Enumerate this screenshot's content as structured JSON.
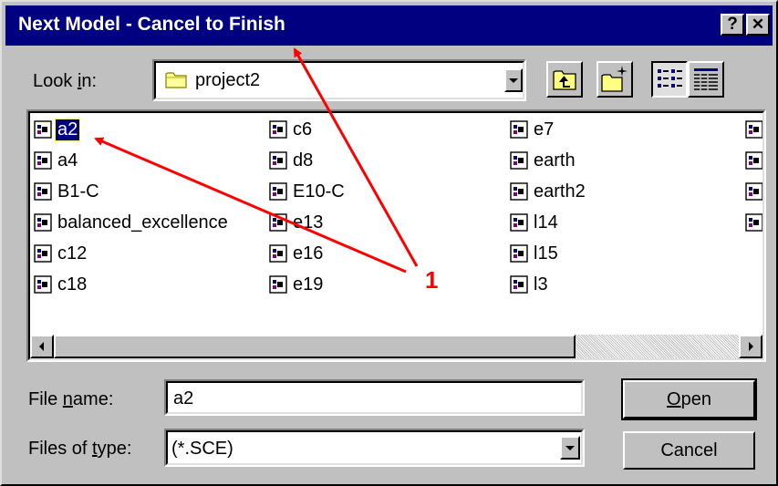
{
  "window": {
    "title": "Next Model - Cancel to Finish",
    "help_label": "?",
    "close_label": "✕"
  },
  "look_in": {
    "label": "Look in:",
    "label_mnemonic_pre": "Look ",
    "label_mnemonic_key": "i",
    "label_mnemonic_post": "n:",
    "value": "project2"
  },
  "toolbar": {
    "icons": [
      "up-one-level-icon",
      "create-new-folder-icon",
      "list-view-icon",
      "details-view-icon"
    ]
  },
  "files": {
    "col1": [
      "a2",
      "a4",
      "B1-C",
      "balanced_excellence",
      "c12",
      "c18"
    ],
    "col2": [
      "c6",
      "d8",
      "E10-C",
      "e13",
      "e16",
      "e19"
    ],
    "col3": [
      "e7",
      "earth",
      "earth2",
      "l14",
      "l15",
      "l3"
    ],
    "selected": "a2"
  },
  "file_name": {
    "label_pre": "File ",
    "label_key": "n",
    "label_post": "ame:",
    "value": "a2"
  },
  "file_type": {
    "label_pre": "Files of ",
    "label_key": "t",
    "label_post": "ype:",
    "value": "(*.SCE)"
  },
  "buttons": {
    "open_key": "O",
    "open_rest": "pen",
    "cancel": "Cancel"
  },
  "annotation": {
    "callout": "1",
    "color": "#ff0000"
  }
}
